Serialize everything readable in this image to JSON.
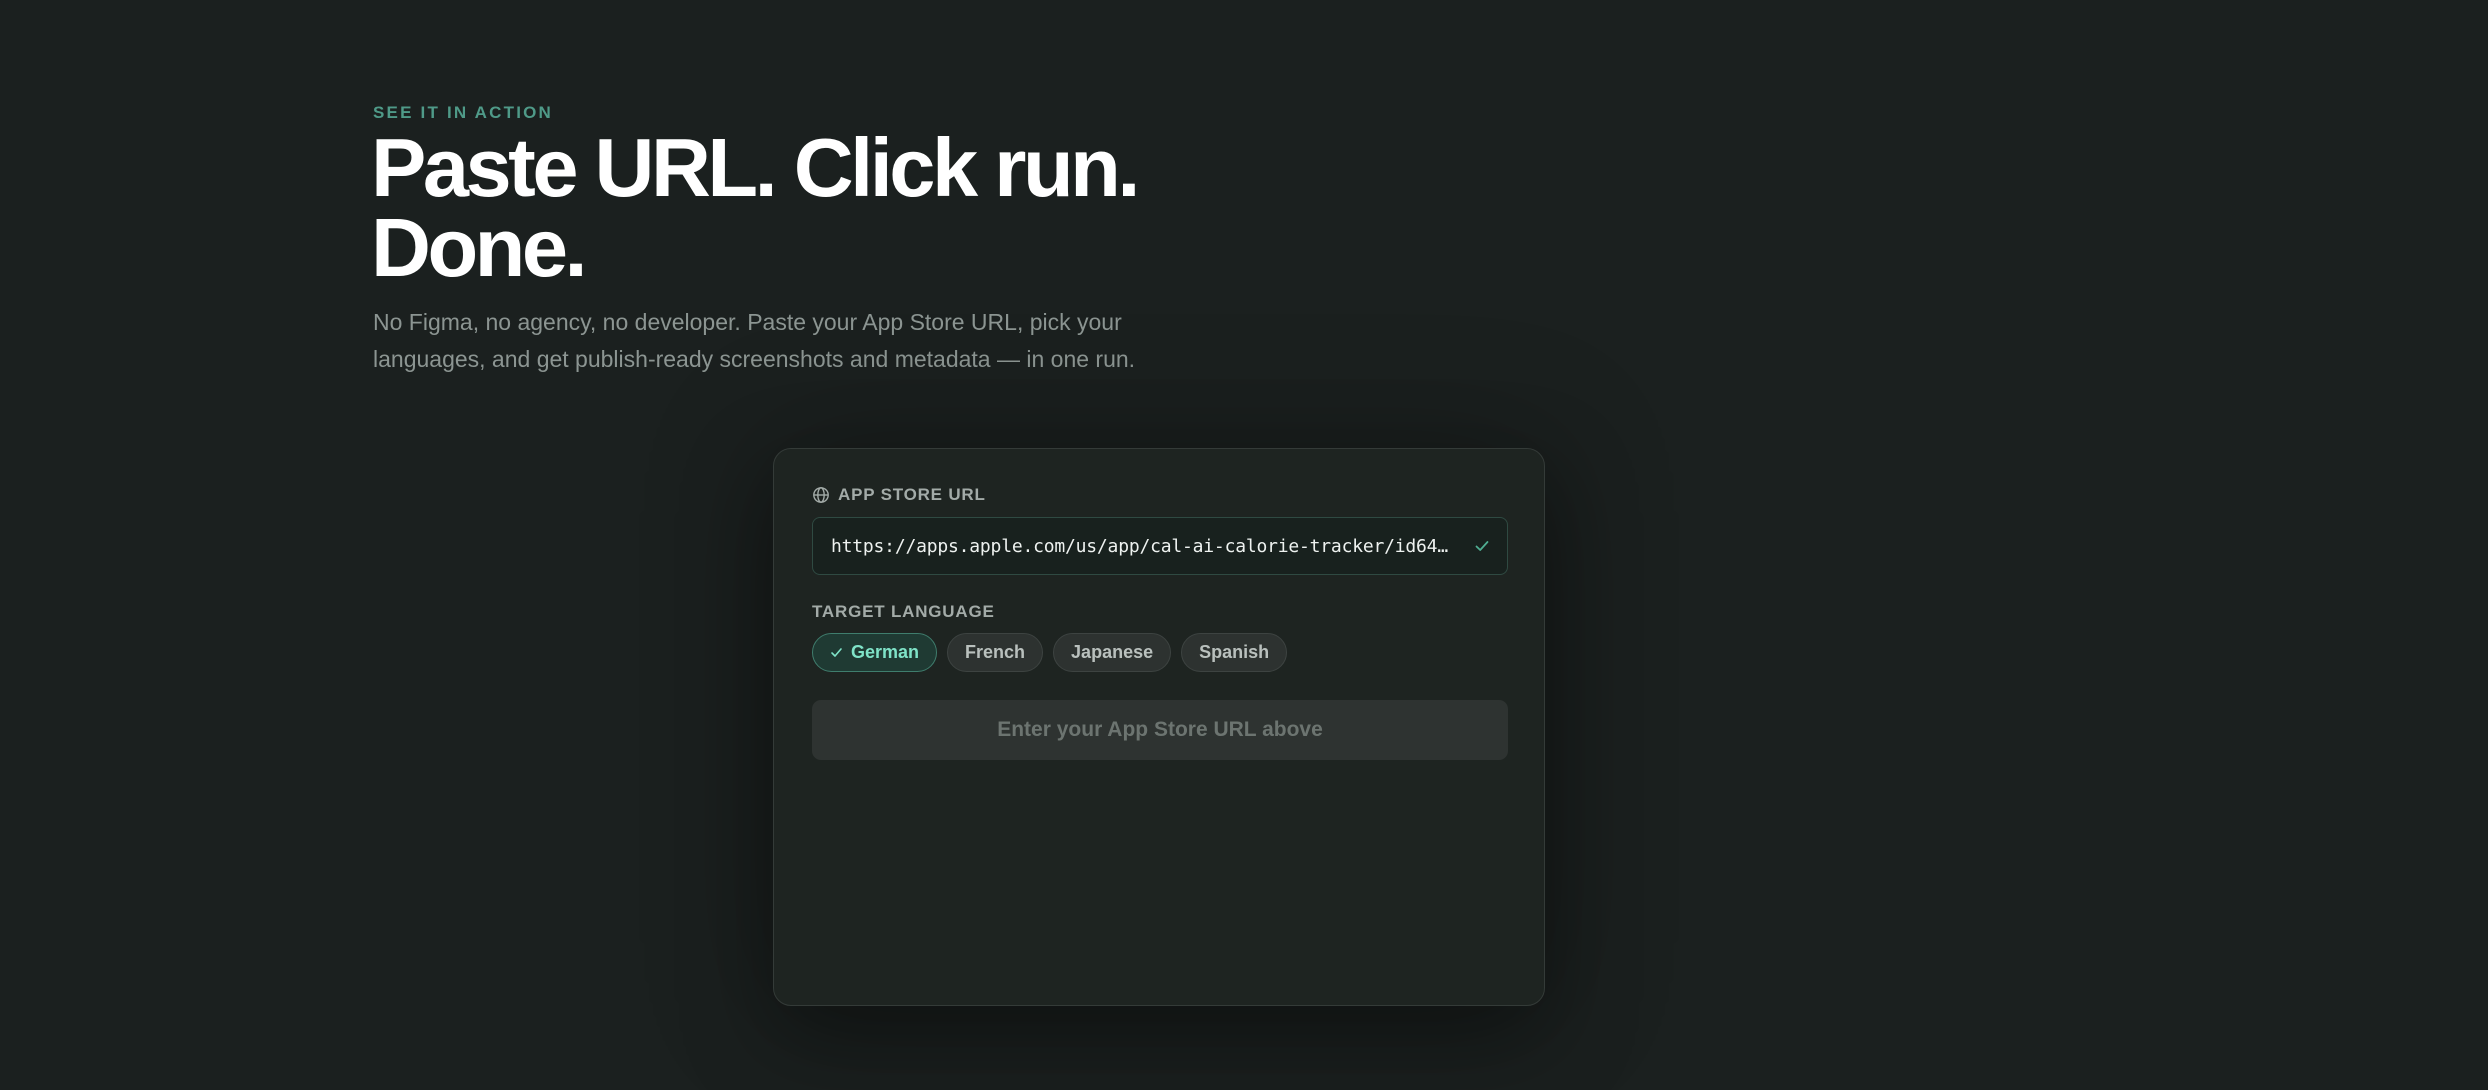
{
  "hero": {
    "eyebrow": "SEE IT IN ACTION",
    "headline_line1": "Paste URL. Click run.",
    "headline_line2": "Done.",
    "lede_line1": "No Figma, no agency, no developer. Paste your App Store URL, pick your",
    "lede_line2": "languages, and get publish-ready screenshots and metadata — in one run."
  },
  "card": {
    "url_field": {
      "label": "APP STORE URL",
      "icon": "globe-icon",
      "value": "https://apps.apple.com/us/app/cal-ai-calorie-tracker/id648…",
      "status_icon": "check-icon"
    },
    "language_field": {
      "label": "TARGET LANGUAGE",
      "options": [
        {
          "label": "German",
          "selected": true
        },
        {
          "label": "French",
          "selected": false
        },
        {
          "label": "Japanese",
          "selected": false
        },
        {
          "label": "Spanish",
          "selected": false
        }
      ]
    },
    "submit_label": "Enter your App Store URL above"
  },
  "colors": {
    "background": "#1b201f",
    "card_background": "#1e2421",
    "accent": "#4f9a88",
    "chip_selected_text": "#7fe3c8",
    "headline": "#ffffff",
    "muted_text": "#8c9592"
  }
}
